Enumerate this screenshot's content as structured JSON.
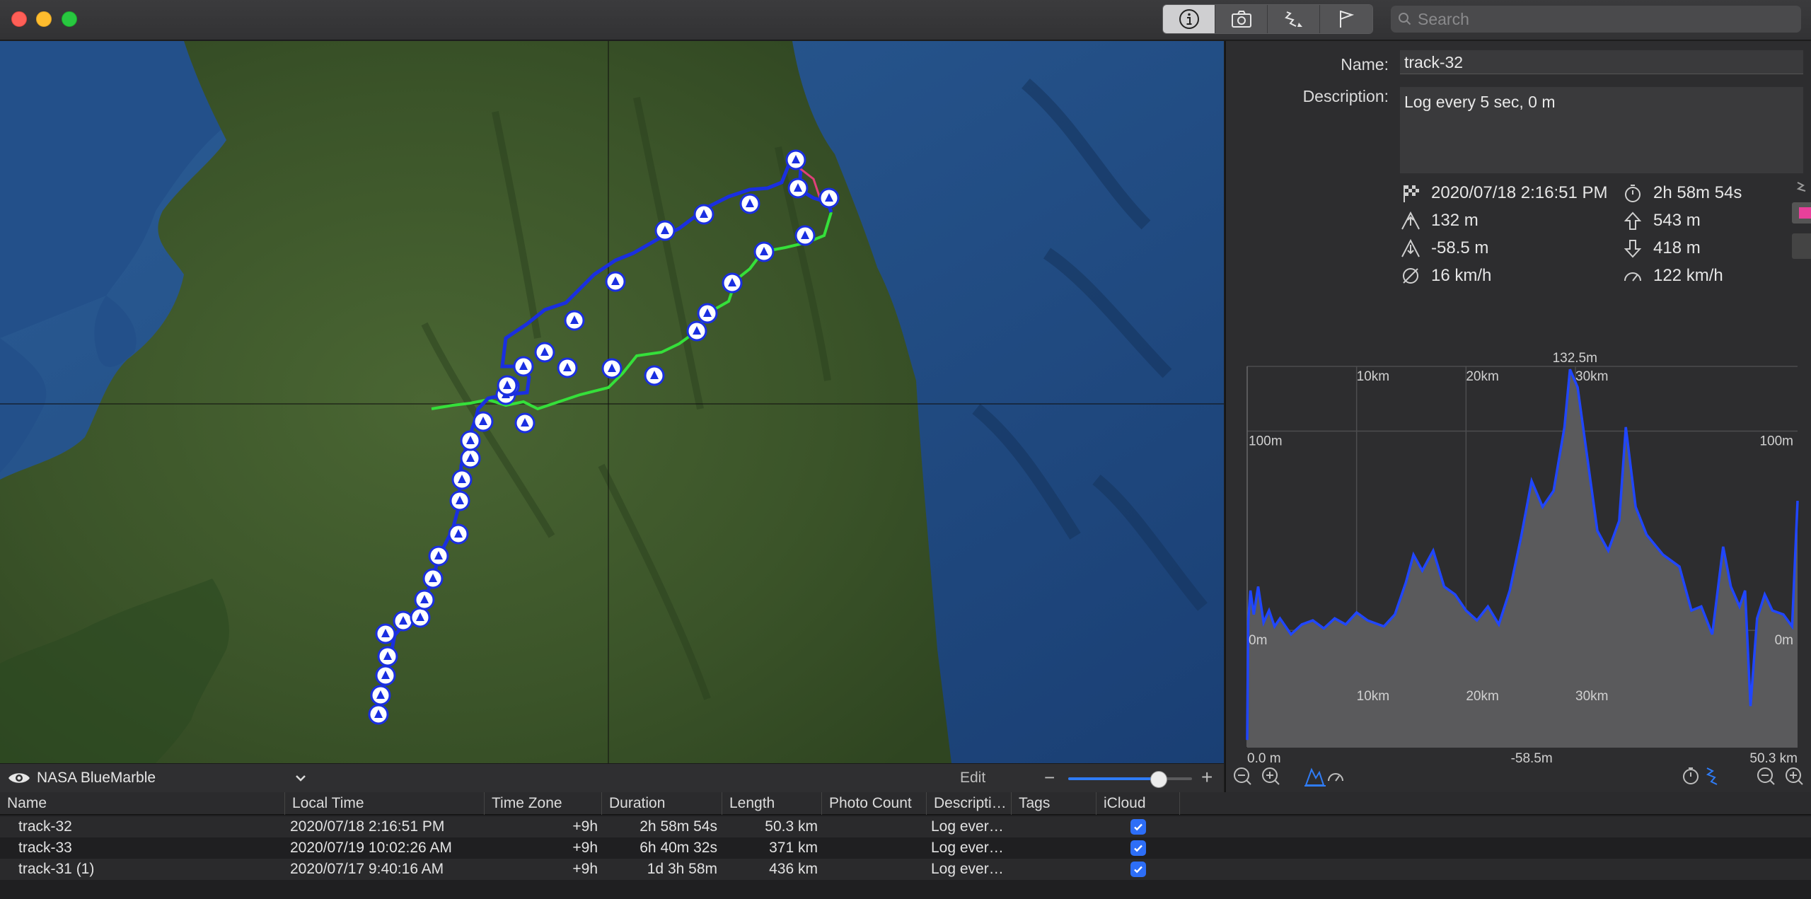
{
  "toolbar": {
    "segments": [
      {
        "icon": "info-icon",
        "active": true
      },
      {
        "icon": "camera-icon",
        "active": false
      },
      {
        "icon": "track-icon",
        "active": false
      },
      {
        "icon": "flag-icon",
        "active": false
      }
    ],
    "search_placeholder": "Search"
  },
  "map": {
    "source": "NASA BlueMarble",
    "edit_label": "Edit",
    "zoom_minus": "−",
    "zoom_plus": "+",
    "zoom_level": 0.73,
    "colors": {
      "track_blue": "#1a2fe0",
      "track_green": "#35e03a",
      "track_pink": "#e0407a",
      "sea": "#214a82",
      "land": "#3c5a2c"
    }
  },
  "info": {
    "name_label": "Name:",
    "name_value": "track-32",
    "description_label": "Description:",
    "description_value": "Log every 5 sec, 0 m",
    "stats": {
      "start": "2020/07/18 2:16:51 PM",
      "duration": "2h 58m 54s",
      "max_altitude": "132 m",
      "ascent": "543 m",
      "min_altitude": "-58.5 m",
      "descent": "418 m",
      "avg_speed": "16 km/h",
      "max_speed": "122 km/h"
    },
    "accent_color": "#e8409a"
  },
  "chart_data": {
    "type": "area",
    "title": "",
    "xlabel": "",
    "ylabel": "",
    "x_unit": "km",
    "y_unit": "m",
    "xlim": [
      0,
      50.3
    ],
    "ylim": [
      -58.5,
      132.5
    ],
    "x_ticks": [
      "10km",
      "20km",
      "30km"
    ],
    "y_ticks": [
      "100m",
      "0m"
    ],
    "top_label": "132.5m",
    "bottom_left_label": "0.0 m",
    "bottom_mid_label": "-58.5m",
    "bottom_right_label": "50.3 km",
    "line_color": "#2046ff",
    "fill_color": "#5a5a5c",
    "series": [
      {
        "x": [
          0,
          0.1,
          0.3,
          0.6,
          1.0,
          1.5,
          2.0,
          2.5,
          3.0,
          4.0,
          5.0,
          6.0,
          7.0,
          8.0,
          9.0,
          10.0,
          11.0,
          12.5,
          13.5,
          14.5,
          15.2,
          16.0,
          17.0,
          18.0,
          19.0,
          20.0,
          21.0,
          22.0,
          23.0,
          24.0,
          25.0,
          26.0,
          27.0,
          28.0,
          29.0,
          29.5,
          30.2,
          31.0,
          32.0,
          33.0,
          34.0,
          34.6,
          35.5,
          36.5,
          38.0,
          39.5,
          40.6,
          41.5,
          42.5,
          43.5,
          44.2,
          45.0,
          45.5,
          46.0,
          46.6,
          47.3,
          48.0,
          49.0,
          49.8,
          50.3
        ],
        "y": [
          -55,
          5,
          20,
          8,
          22,
          4,
          10,
          2,
          6,
          -2,
          3,
          5,
          1,
          6,
          3,
          9,
          5,
          2,
          8,
          24,
          38,
          30,
          40,
          22,
          18,
          10,
          5,
          12,
          3,
          20,
          46,
          75,
          62,
          70,
          102,
          131,
          122,
          90,
          50,
          40,
          55,
          102,
          62,
          48,
          38,
          32,
          10,
          12,
          -2,
          42,
          22,
          12,
          20,
          -38,
          6,
          18,
          10,
          8,
          2,
          65
        ]
      }
    ]
  },
  "table": {
    "columns": [
      "Name",
      "Local Time",
      "Time Zone",
      "Duration",
      "Length",
      "Photo Count",
      "Descripti…",
      "Tags",
      "iCloud"
    ],
    "rows": [
      {
        "name": "track-32",
        "local_time": "2020/07/18 2:16:51 PM",
        "time_zone": "+9h",
        "duration": "2h 58m 54s",
        "length": "50.3 km",
        "photo_count": "",
        "description": "Log ever…",
        "tags": "",
        "icloud": true
      },
      {
        "name": "track-33",
        "local_time": "2020/07/19 10:02:26 AM",
        "time_zone": "+9h",
        "duration": "6h 40m 32s",
        "length": "371 km",
        "photo_count": "",
        "description": "Log ever…",
        "tags": "",
        "icloud": true
      },
      {
        "name": "track-31 (1)",
        "local_time": "2020/07/17 9:40:16 AM",
        "time_zone": "+9h",
        "duration": "1d 3h 58m",
        "length": "436 km",
        "photo_count": "",
        "description": "Log ever…",
        "tags": "",
        "icloud": true
      }
    ]
  }
}
